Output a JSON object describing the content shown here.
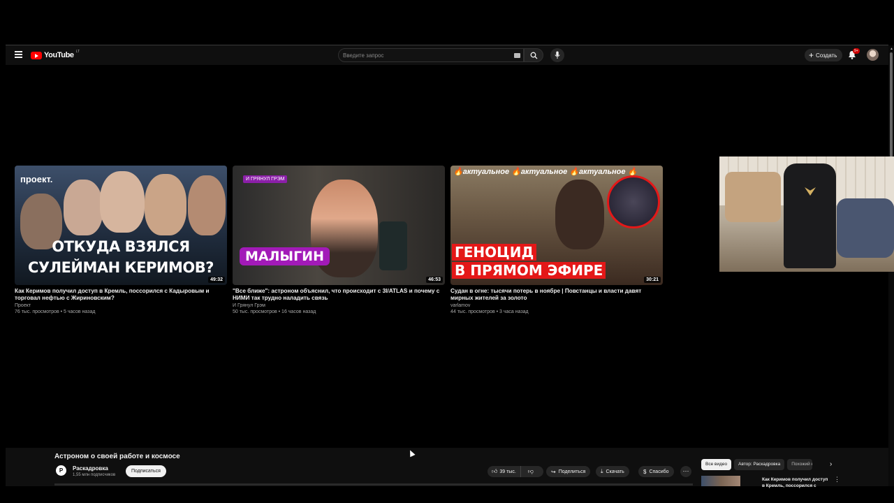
{
  "masthead": {
    "logo_text": "YouTube",
    "logo_sup": "LT",
    "search_placeholder": "Введите запрос",
    "create_label": "Создать",
    "notifications_badge": "9+"
  },
  "videos": [
    {
      "title": "Как Керимов получил доступ в Кремль, поссорился с Кадыровым и торговал нефтью с Жириновским?",
      "channel": "Проект",
      "views": "76 тыс. просмотров",
      "age": "5 часов назад",
      "duration": "49:32",
      "thumb_brand": "проект.",
      "thumb_line1": "ОТКУДА ВЗЯЛСЯ",
      "thumb_line2": "СУЛЕЙМАН КЕРИМОВ?"
    },
    {
      "title": "\"Все ближе\": астроном объяснил, что происходит с 3I/ATLAS и почему с НИМИ так трудно наладить связь",
      "channel": "И Грянул Грэм",
      "views": "50 тыс. просмотров",
      "age": "16 часов назад",
      "duration": "46:53",
      "thumb_tag": "И ГРЯНУЛ ГРЭМ",
      "thumb_name": "МАЛЫГИН"
    },
    {
      "title": "Судан в огне: тысячи потерь в ноябре | Повстанцы и власти давят мирных жителей за золото",
      "channel": "varlamov",
      "views": "44 тыс. просмотров",
      "age": "3 часа назад",
      "duration": "30:21",
      "thumb_top": "🔥актуальное 🔥актуальное 🔥актуальное 🔥",
      "thumb_line1": "ГЕНОЦИД",
      "thumb_line2": "В ПРЯМОМ ЭФИРЕ"
    }
  ],
  "watch": {
    "title": "Астроном о своей работе и космосе",
    "channel_name": "Раскадровка",
    "channel_initial": "P",
    "subscribers": "1,55 млн подписчиков",
    "subscribe_label": "Подписаться",
    "likes": "39 тыс.",
    "share_label": "Поделиться",
    "download_label": "Скачать",
    "thanks_label": "Спасибо",
    "more_label": "···"
  },
  "sidebar": {
    "chips": [
      "Все видео",
      "Автор: Раскадровка",
      "Похожий к"
    ],
    "related_title": "Как Керимов получил доступ в Кремль, поссорился с"
  },
  "colors": {
    "background": "#000000",
    "surface": "#0f0f0f",
    "pill": "#272727",
    "accent_red": "#ff0000",
    "purple_tag": "#a21ab8"
  }
}
